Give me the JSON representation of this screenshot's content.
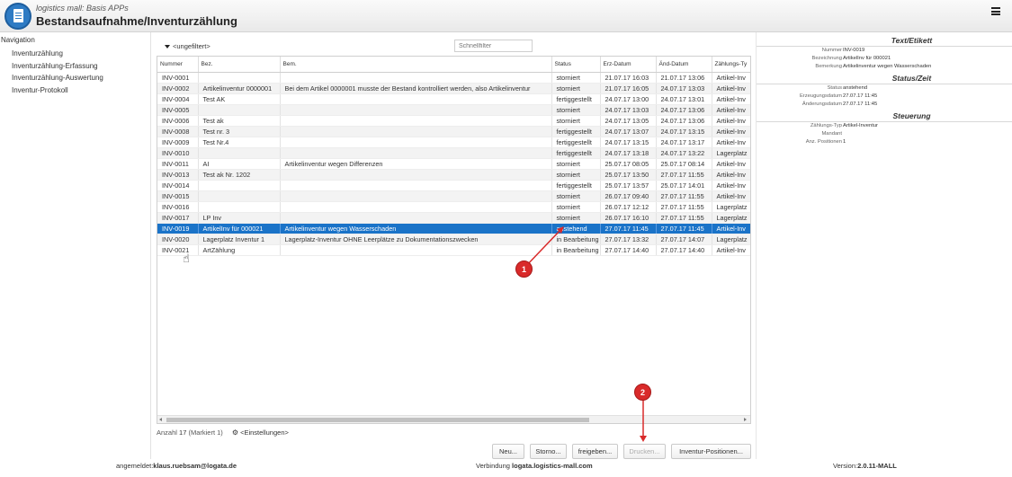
{
  "header": {
    "subtitle": "logistics mall: Basis APPs",
    "title": "Bestandsaufnahme/Inventurzählung"
  },
  "sidebar": {
    "title": "Navigation",
    "items": [
      {
        "label": "Inventurzählung"
      },
      {
        "label": "Inventurzählung-Erfassung"
      },
      {
        "label": "Inventurzählung-Auswertung"
      },
      {
        "label": "Inventur-Protokoll"
      }
    ]
  },
  "filter": {
    "label": "<ungefiltert>",
    "quickfilter_placeholder": "Schnellfilter"
  },
  "table": {
    "columns": [
      "Nummer",
      "Bez.",
      "Bem.",
      "Status",
      "Erz-Datum",
      "Änd-Datum",
      "Zählungs-Ty"
    ],
    "rows": [
      {
        "nummer": "INV-0001",
        "bez": "",
        "bem": "",
        "status": "storniert",
        "erz": "21.07.17 16:03",
        "aend": "21.07.17 13:06",
        "typ": "Artikel-Inv"
      },
      {
        "nummer": "INV-0002",
        "bez": "Artikelinventur 0000001",
        "bem": "Bei dem Artikel 0000001 musste der Bestand kontrolliert werden, also Artikelinventur",
        "status": "storniert",
        "erz": "21.07.17 16:05",
        "aend": "24.07.17 13:03",
        "typ": "Artikel-Inv"
      },
      {
        "nummer": "INV-0004",
        "bez": "Test AK",
        "bem": "",
        "status": "fertiggestellt",
        "erz": "24.07.17 13:00",
        "aend": "24.07.17 13:01",
        "typ": "Artikel-Inv"
      },
      {
        "nummer": "INV-0005",
        "bez": "",
        "bem": "",
        "status": "storniert",
        "erz": "24.07.17 13:03",
        "aend": "24.07.17 13:06",
        "typ": "Artikel-Inv"
      },
      {
        "nummer": "INV-0006",
        "bez": "Test ak",
        "bem": "",
        "status": "storniert",
        "erz": "24.07.17 13:05",
        "aend": "24.07.17 13:06",
        "typ": "Artikel-Inv"
      },
      {
        "nummer": "INV-0008",
        "bez": "Test nr. 3",
        "bem": "",
        "status": "fertiggestellt",
        "erz": "24.07.17 13:07",
        "aend": "24.07.17 13:15",
        "typ": "Artikel-Inv"
      },
      {
        "nummer": "INV-0009",
        "bez": "Test Nr.4",
        "bem": "",
        "status": "fertiggestellt",
        "erz": "24.07.17 13:15",
        "aend": "24.07.17 13:17",
        "typ": "Artikel-Inv"
      },
      {
        "nummer": "INV-0010",
        "bez": "",
        "bem": "",
        "status": "fertiggestellt",
        "erz": "24.07.17 13:18",
        "aend": "24.07.17 13:22",
        "typ": "Lagerplatz"
      },
      {
        "nummer": "INV-0011",
        "bez": "AI",
        "bem": "Artikelinventur wegen Differenzen",
        "status": "storniert",
        "erz": "25.07.17 08:05",
        "aend": "25.07.17 08:14",
        "typ": "Artikel-Inv"
      },
      {
        "nummer": "INV-0013",
        "bez": "Test ak Nr. 1202",
        "bem": "",
        "status": "storniert",
        "erz": "25.07.17 13:50",
        "aend": "27.07.17 11:55",
        "typ": "Artikel-Inv"
      },
      {
        "nummer": "INV-0014",
        "bez": "",
        "bem": "",
        "status": "fertiggestellt",
        "erz": "25.07.17 13:57",
        "aend": "25.07.17 14:01",
        "typ": "Artikel-Inv"
      },
      {
        "nummer": "INV-0015",
        "bez": "",
        "bem": "",
        "status": "storniert",
        "erz": "26.07.17 09:40",
        "aend": "27.07.17 11:55",
        "typ": "Artikel-Inv"
      },
      {
        "nummer": "INV-0016",
        "bez": "",
        "bem": "",
        "status": "storniert",
        "erz": "26.07.17 12:12",
        "aend": "27.07.17 11:55",
        "typ": "Lagerplatz"
      },
      {
        "nummer": "INV-0017",
        "bez": "LP Inv",
        "bem": "",
        "status": "storniert",
        "erz": "26.07.17 16:10",
        "aend": "27.07.17 11:55",
        "typ": "Lagerplatz"
      },
      {
        "nummer": "INV-0019",
        "bez": "ArtikelInv für 000021",
        "bem": "Artikelinventur wegen Wasserschaden",
        "status": "anstehend",
        "erz": "27.07.17 11:45",
        "aend": "27.07.17 11:45",
        "typ": "Artikel-Inv"
      },
      {
        "nummer": "INV-0020",
        "bez": "Lagerplatz Inventur 1",
        "bem": "Lagerplatz-Inventur OHNE Leerplätze zu Dokumentationszwecken",
        "status": "in Bearbeitung",
        "erz": "27.07.17 13:32",
        "aend": "27.07.17 14:07",
        "typ": "Lagerplatz"
      },
      {
        "nummer": "INV-0021",
        "bez": "ArtZählung",
        "bem": "",
        "status": "in Bearbeitung",
        "erz": "27.07.17 14:40",
        "aend": "27.07.17 14:40",
        "typ": "Artikel-Inv"
      }
    ],
    "selected_index": 14
  },
  "count": {
    "label": "Anzahl",
    "value": "17",
    "marked": "(Markiert 1)",
    "settings_label": "<Einstellungen>"
  },
  "buttons": {
    "new": "Neu...",
    "storno": "Storno...",
    "release": "freigeben...",
    "print": "Drucken...",
    "positions": "Inventur-Positionen..."
  },
  "detail": {
    "text_section": "Text/Etikett",
    "text_fields": [
      {
        "key": "Nummer",
        "value": "INV-0019"
      },
      {
        "key": "Bezeichnung",
        "value": "ArtikelInv für 000021"
      },
      {
        "key": "Bemerkung",
        "value": "Artikelinventur wegen Wasserschaden"
      }
    ],
    "status_section": "Status/Zeit",
    "status_fields": [
      {
        "key": "Status",
        "value": "anstehend"
      },
      {
        "key": "Erzeugungsdatum",
        "value": "27.07.17 11:45"
      },
      {
        "key": "Änderungsdatum",
        "value": "27.07.17 11:45"
      }
    ],
    "control_section": "Steuerung",
    "control_fields": [
      {
        "key": "Zählungs-Typ",
        "value": "Artikel-Inventur"
      },
      {
        "key": "Mandant",
        "value": ""
      },
      {
        "key": "Anz. Positionen",
        "value": "1"
      }
    ]
  },
  "footer": {
    "user_label": "angemeldet:",
    "user": "klaus.ruebsam@logata.de",
    "conn_label": "Verbindung",
    "conn": "logata.logistics-mall.com",
    "ver_label": "Version:",
    "ver": "2.0.11-MALL"
  },
  "markers": [
    "1",
    "2"
  ],
  "colors": {
    "selected_row": "#1a73c8",
    "marker": "#d92a2a"
  }
}
